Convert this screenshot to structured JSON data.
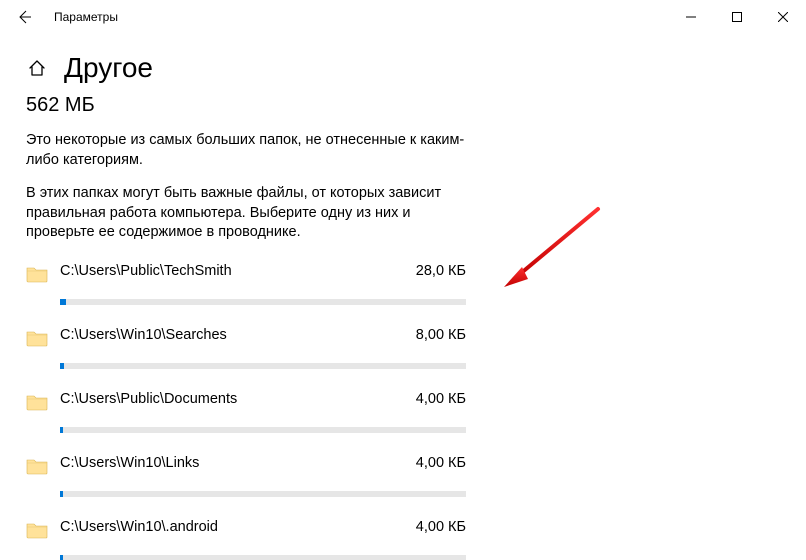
{
  "window": {
    "title": "Параметры"
  },
  "page": {
    "title": "Другое",
    "total_size": "562 МБ",
    "desc1": "Это некоторые из самых больших папок, не отнесенные к каким-либо категориям.",
    "desc2": "В этих папках могут быть важные файлы, от которых зависит правильная работа компьютера. Выберите одну из них и проверьте ее содержимое в проводнике."
  },
  "folders": [
    {
      "path": "C:\\Users\\Public\\TechSmith",
      "size": "28,0 КБ",
      "fill_pct": 1.4
    },
    {
      "path": "C:\\Users\\Win10\\Searches",
      "size": "8,00 КБ",
      "fill_pct": 1.0
    },
    {
      "path": "C:\\Users\\Public\\Documents",
      "size": "4,00 КБ",
      "fill_pct": 0.8
    },
    {
      "path": "C:\\Users\\Win10\\Links",
      "size": "4,00 КБ",
      "fill_pct": 0.8
    },
    {
      "path": "C:\\Users\\Win10\\.android",
      "size": "4,00 КБ",
      "fill_pct": 0.8
    }
  ]
}
